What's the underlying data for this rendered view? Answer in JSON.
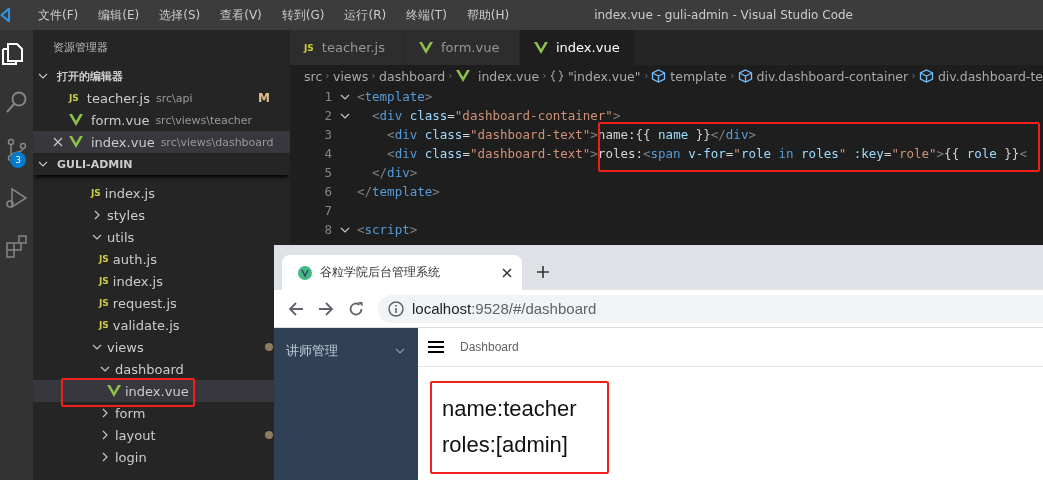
{
  "menu": [
    "文件(F)",
    "编辑(E)",
    "选择(S)",
    "查看(V)",
    "转到(G)",
    "运行(R)",
    "终端(T)",
    "帮助(H)"
  ],
  "window": {
    "title": "index.vue - guli-admin - Visual Studio Code"
  },
  "activity_bar": [
    {
      "kind": "files",
      "selected": true
    },
    {
      "kind": "search",
      "selected": false
    },
    {
      "kind": "source-control",
      "selected": false,
      "badge": "3"
    },
    {
      "kind": "run",
      "selected": false
    },
    {
      "kind": "extensions",
      "selected": false
    }
  ],
  "sidebar": {
    "title": "资源管理器",
    "open_editors": {
      "title": "打开的编辑器",
      "expanded": true,
      "items": [
        {
          "name": "teacher.js",
          "kind": "js",
          "icon_text": "JS",
          "path": "src\\api",
          "badge": "M",
          "selected": false
        },
        {
          "name": "form.vue",
          "kind": "vue",
          "path": "src\\views\\teacher",
          "selected": false
        },
        {
          "name": "index.vue",
          "kind": "vue",
          "path": "src\\views\\dashboard",
          "selected": true
        }
      ]
    },
    "project": {
      "title": "GULI-ADMIN",
      "expanded": true,
      "tree": [
        {
          "name": "index.js",
          "kind": "js",
          "icon_text": "JS",
          "selected": false
        },
        {
          "name": "styles",
          "kind": "folder",
          "expanded": false,
          "selected": false
        },
        {
          "name": "utils",
          "kind": "folder",
          "expanded": true,
          "selected": false,
          "children": [
            {
              "name": "auth.js",
              "kind": "js",
              "icon_text": "JS",
              "selected": false
            },
            {
              "name": "index.js",
              "kind": "js",
              "icon_text": "JS",
              "selected": false
            },
            {
              "name": "request.js",
              "kind": "js",
              "icon_text": "JS",
              "selected": false
            },
            {
              "name": "validate.js",
              "kind": "js",
              "icon_text": "JS",
              "selected": false
            }
          ]
        },
        {
          "name": "views",
          "kind": "folder",
          "expanded": true,
          "modified": true,
          "selected": false,
          "children": [
            {
              "name": "dashboard",
              "kind": "folder",
              "expanded": true,
              "selected": false,
              "children": [
                {
                  "name": "index.vue",
                  "kind": "vue",
                  "selected": true
                }
              ]
            },
            {
              "name": "form",
              "kind": "folder",
              "expanded": false,
              "selected": false
            },
            {
              "name": "layout",
              "kind": "folder",
              "expanded": false,
              "modified": true,
              "selected": false
            },
            {
              "name": "login",
              "kind": "folder",
              "expanded": false,
              "selected": false
            }
          ]
        }
      ]
    }
  },
  "editor": {
    "tabs": [
      {
        "name": "teacher.js",
        "kind": "js",
        "icon_text": "JS",
        "selected": false
      },
      {
        "name": "form.vue",
        "kind": "vue",
        "selected": false
      },
      {
        "name": "index.vue",
        "kind": "vue",
        "selected": true
      }
    ],
    "breadcrumb": [
      {
        "label": "src",
        "kind": "folder"
      },
      {
        "label": "views",
        "kind": "folder"
      },
      {
        "label": "dashboard",
        "kind": "folder"
      },
      {
        "label": "index.vue",
        "kind": "file"
      },
      {
        "label": "\"index.vue\"",
        "kind": "object"
      },
      {
        "label": "template",
        "kind": "element"
      },
      {
        "label": "div.dashboard-container",
        "kind": "element"
      },
      {
        "label": "div.dashboard-te",
        "kind": "element"
      }
    ],
    "lines": [
      {
        "number": "1",
        "foldable": true,
        "tokens": [
          {
            "kind": "punct",
            "text": "<"
          },
          {
            "kind": "tag",
            "text": "template"
          },
          {
            "kind": "punct",
            "text": ">"
          }
        ]
      },
      {
        "number": "2",
        "foldable": true,
        "tokens": [
          {
            "kind": "punct",
            "text": "  <"
          },
          {
            "kind": "tag",
            "text": "div"
          },
          {
            "kind": "attr",
            "text": " class"
          },
          {
            "kind": "text",
            "text": "="
          },
          {
            "kind": "string",
            "text": "\"dashboard-container\""
          },
          {
            "kind": "punct",
            "text": ">"
          }
        ]
      },
      {
        "number": "3",
        "foldable": false,
        "tokens": [
          {
            "kind": "punct",
            "text": "    <"
          },
          {
            "kind": "tag",
            "text": "div"
          },
          {
            "kind": "attr",
            "text": " class"
          },
          {
            "kind": "text",
            "text": "="
          },
          {
            "kind": "string",
            "text": "\"dashboard-text\""
          },
          {
            "kind": "punct",
            "text": ">"
          },
          {
            "kind": "text",
            "text": "name:{{ "
          },
          {
            "kind": "attr",
            "text": "name"
          },
          {
            "kind": "text",
            "text": " }}"
          },
          {
            "kind": "punct",
            "text": "</"
          },
          {
            "kind": "tag",
            "text": "div"
          },
          {
            "kind": "punct",
            "text": ">"
          }
        ]
      },
      {
        "number": "4",
        "foldable": false,
        "tokens": [
          {
            "kind": "punct",
            "text": "    <"
          },
          {
            "kind": "tag",
            "text": "div"
          },
          {
            "kind": "attr",
            "text": " class"
          },
          {
            "kind": "text",
            "text": "="
          },
          {
            "kind": "string",
            "text": "\"dashboard-text\""
          },
          {
            "kind": "punct",
            "text": ">"
          },
          {
            "kind": "text",
            "text": "roles:"
          },
          {
            "kind": "punct",
            "text": "<"
          },
          {
            "kind": "tag",
            "text": "span"
          },
          {
            "kind": "attr",
            "text": " v-for"
          },
          {
            "kind": "text",
            "text": "="
          },
          {
            "kind": "string",
            "text": "\""
          },
          {
            "kind": "attr",
            "text": "role"
          },
          {
            "kind": "tag",
            "text": " in"
          },
          {
            "kind": "attr",
            "text": " roles"
          },
          {
            "kind": "string",
            "text": "\""
          },
          {
            "kind": "attr",
            "text": " :key"
          },
          {
            "kind": "text",
            "text": "="
          },
          {
            "kind": "string",
            "text": "\"role\""
          },
          {
            "kind": "punct",
            "text": ">"
          },
          {
            "kind": "text",
            "text": "{{ "
          },
          {
            "kind": "attr",
            "text": "role"
          },
          {
            "kind": "text",
            "text": " }}"
          },
          {
            "kind": "punct",
            "text": "<"
          }
        ]
      },
      {
        "number": "5",
        "foldable": false,
        "tokens": [
          {
            "kind": "punct",
            "text": "  </"
          },
          {
            "kind": "tag",
            "text": "div"
          },
          {
            "kind": "punct",
            "text": ">"
          }
        ]
      },
      {
        "number": "6",
        "foldable": false,
        "tokens": [
          {
            "kind": "punct",
            "text": "</"
          },
          {
            "kind": "tag",
            "text": "template"
          },
          {
            "kind": "punct",
            "text": ">"
          }
        ]
      },
      {
        "number": "7",
        "foldable": false
      },
      {
        "number": "8",
        "foldable": true,
        "tokens": [
          {
            "kind": "punct",
            "text": "<"
          },
          {
            "kind": "tag",
            "text": "script"
          },
          {
            "kind": "punct",
            "text": ">"
          }
        ]
      }
    ]
  },
  "browser": {
    "tab": {
      "title": "谷粒学院后台管理系统",
      "selected": true
    },
    "address": {
      "host": "localhost",
      "rest": ":9528/#/dashboard"
    },
    "page": {
      "menu": [
        {
          "label": "讲师管理",
          "expanded": false
        }
      ],
      "breadcrumb": "Dashboard",
      "lines": [
        "name:teacher",
        "roles:[admin]"
      ]
    }
  },
  "highlights": [
    {
      "kind": "code"
    },
    {
      "kind": "tree"
    },
    {
      "kind": "page"
    }
  ]
}
